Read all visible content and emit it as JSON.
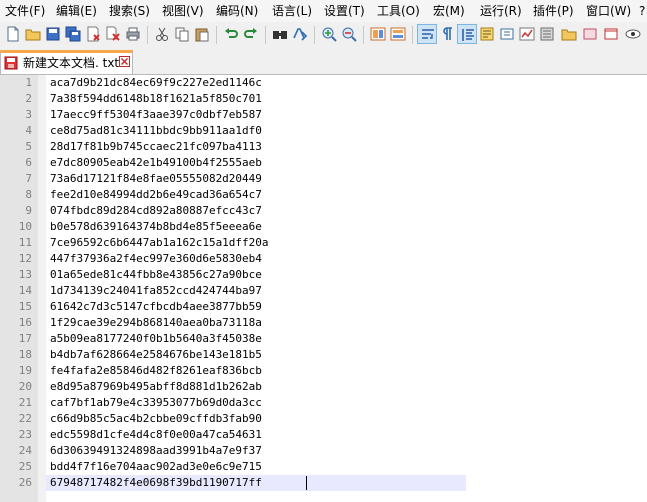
{
  "menu": [
    "文件(F)",
    "编辑(E)",
    "搜索(S)",
    "视图(V)",
    "编码(N)",
    "语言(L)",
    "设置(T)",
    "工具(O)",
    "宏(M)",
    "运行(R)",
    "插件(P)",
    "窗口(W)"
  ],
  "menu_more": "?",
  "tab": {
    "label": "新建文本文档. txt",
    "close_icon": "close-icon"
  },
  "editor": {
    "line_numbers": [
      "1",
      "2",
      "3",
      "4",
      "5",
      "6",
      "7",
      "8",
      "9",
      "10",
      "11",
      "12",
      "13",
      "14",
      "15",
      "16",
      "17",
      "18",
      "19",
      "20",
      "21",
      "22",
      "23",
      "24",
      "25",
      "26"
    ],
    "lines": [
      "aca7d9b21dc84ec69f9c227e2ed1146c",
      "7a38f594dd6148b18f1621a5f850c701",
      "17aecc9ff5304f3aae397c0dbf7eb587",
      "ce8d75ad81c34111bbdc9bb911aa1df0",
      "28d17f81b9b745ccaec21fc097ba4113",
      "e7dc80905eab42e1b49100b4f2555aeb",
      "73a6d17121f84e8fae05555082d20449",
      "fee2d10e84994dd2b6e49cad36a654c7",
      "074fbdc89d284cd892a80887efcc43c7",
      "b0e578d639164374b8bd4e85f5eeea6e",
      "7ce96592c6b6447ab1a162c15a1dff20a",
      "447f37936a2f4ec997e360d6e5830eb4",
      "01a65ede81c44fbb8e43856c27a90bce",
      "1d734139c24041fa852ccd424744ba97",
      "61642c7d3c5147cfbcdb4aee3877bb59",
      "1f29cae39e294b868140aea0ba73118a",
      "a5b09ea8177240f0b1b5640a3f45038e",
      "b4db7af628664e2584676be143e181b5",
      "fe4fafa2e85846d482f8261eaf836bcb",
      "e8d95a87969b495abff8d881d1b262ab",
      "caf7bf1ab79e4c33953077b69d0da3cc",
      "c66d9b85c5ac4b2cbbe09cffdb3fab90",
      "edc5598d1cfe4d4c8f0e00a47ca54631",
      "6d30639491324898aad3991b4a7e9f37",
      "bdd4f7f16e704aac902ad3e0e6c9e715",
      "67948717482f4e0698f39bd1190717ff"
    ],
    "current_line": 26
  },
  "colors": {
    "tab_accent": "#f7a64a",
    "current_line_bg": "#e8e8ff",
    "gutter_bg": "#e4e4e4",
    "line_number": "#808080"
  },
  "toolbar_icons": [
    "new-file-icon",
    "open-file-icon",
    "save-icon",
    "save-all-icon",
    "close-icon",
    "close-all-icon",
    "print-icon",
    "cut-icon",
    "copy-icon",
    "paste-icon",
    "undo-icon",
    "redo-icon",
    "find-icon",
    "replace-icon",
    "zoom-in-icon",
    "zoom-out-icon",
    "sync-vertical-icon",
    "sync-horizontal-icon",
    "word-wrap-icon",
    "show-all-characters-icon",
    "indent-guide-icon",
    "document-map-icon",
    "function-list-icon",
    "folder-workspace-icon",
    "monitoring-icon"
  ]
}
